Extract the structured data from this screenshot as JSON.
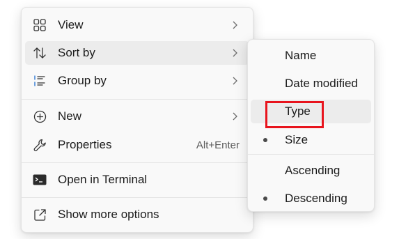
{
  "main_menu": {
    "items": [
      {
        "label": "View",
        "icon": "grid-icon",
        "has_submenu": true
      },
      {
        "label": "Sort by",
        "icon": "sort-arrows-icon",
        "has_submenu": true
      },
      {
        "label": "Group by",
        "icon": "list-group-icon",
        "has_submenu": true
      },
      {
        "label": "New",
        "icon": "plus-circle-icon",
        "has_submenu": true
      },
      {
        "label": "Properties",
        "icon": "wrench-icon",
        "shortcut": "Alt+Enter"
      },
      {
        "label": "Open in Terminal",
        "icon": "terminal-icon"
      },
      {
        "label": "Show more options",
        "icon": "share-icon"
      }
    ]
  },
  "sort_submenu": {
    "items": [
      {
        "label": "Name"
      },
      {
        "label": "Date modified"
      },
      {
        "label": "Type"
      },
      {
        "label": "Size",
        "selected": true
      },
      {
        "label": "Ascending"
      },
      {
        "label": "Descending",
        "selected": true
      }
    ]
  },
  "colors": {
    "highlight_border": "#e8141d",
    "hover_background": "#ececec",
    "menu_background": "#f9f9f9"
  }
}
